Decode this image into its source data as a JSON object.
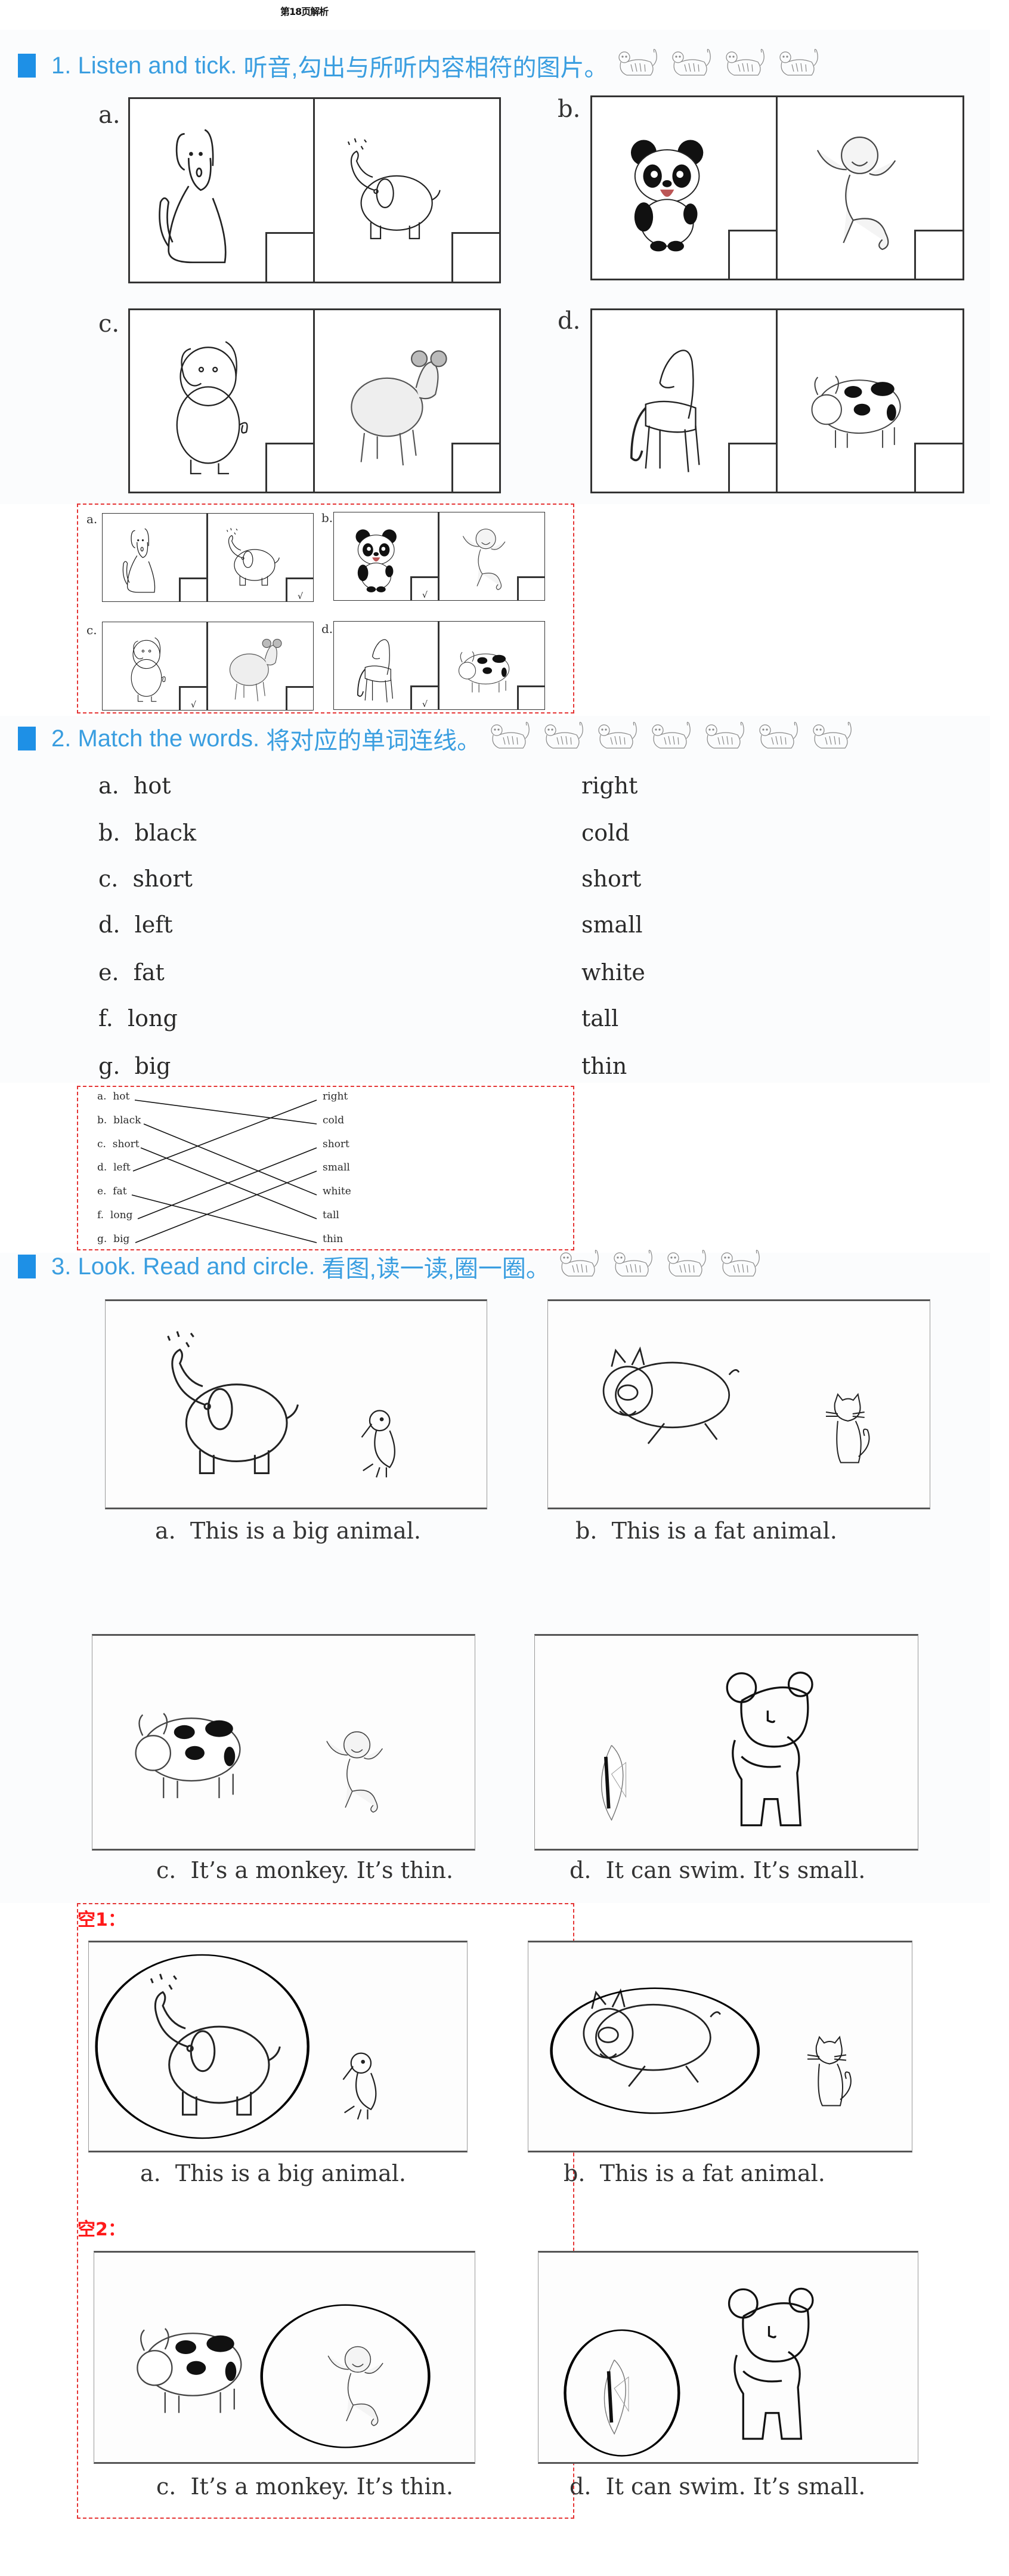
{
  "page_title": "第18页解析",
  "sections": [
    {
      "number": "1.",
      "title_en": "Listen and tick.",
      "title_zh": "听音,勾出与所听内容相符的图片。",
      "decorative_icon": "tiger-icon",
      "decorative_count": 4,
      "items": [
        {
          "letter": "a.",
          "left_animal": "dog",
          "right_animal": "elephant",
          "answer": "right"
        },
        {
          "letter": "b.",
          "left_animal": "panda",
          "right_animal": "monkey",
          "answer": "left"
        },
        {
          "letter": "c.",
          "left_animal": "pig",
          "right_animal": "sheep",
          "answer": "left"
        },
        {
          "letter": "d.",
          "left_animal": "horse",
          "right_animal": "cow",
          "answer": "left"
        }
      ],
      "tick_mark": "√"
    },
    {
      "number": "2.",
      "title_en": "Match the words.",
      "title_zh": "将对应的单词连线。",
      "decorative_icon": "tiger-icon",
      "decorative_count": 7,
      "left_words": [
        {
          "letter": "a.",
          "word": "hot"
        },
        {
          "letter": "b.",
          "word": "black"
        },
        {
          "letter": "c.",
          "word": "short"
        },
        {
          "letter": "d.",
          "word": "left"
        },
        {
          "letter": "e.",
          "word": "fat"
        },
        {
          "letter": "f.",
          "word": "long"
        },
        {
          "letter": "g.",
          "word": "big"
        }
      ],
      "right_words": [
        "right",
        "cold",
        "short",
        "small",
        "white",
        "tall",
        "thin"
      ],
      "matches": [
        {
          "from": "hot",
          "to": "cold"
        },
        {
          "from": "black",
          "to": "white"
        },
        {
          "from": "short",
          "to": "tall"
        },
        {
          "from": "left",
          "to": "right"
        },
        {
          "from": "fat",
          "to": "thin"
        },
        {
          "from": "long",
          "to": "short"
        },
        {
          "from": "big",
          "to": "small"
        }
      ]
    },
    {
      "number": "3.",
      "title_en": "Look. Read and circle.",
      "title_zh": "看图,读一读,圈一圈。",
      "decorative_icon": "tiger-icon",
      "decorative_count": 4,
      "items": [
        {
          "letter": "a.",
          "sentence": "This is a big animal.",
          "animals": [
            "elephant",
            "bird"
          ],
          "answer": "elephant"
        },
        {
          "letter": "b.",
          "sentence": "This is a fat animal.",
          "animals": [
            "pig",
            "cat"
          ],
          "answer": "pig"
        },
        {
          "letter": "c.",
          "sentence": "It’s a monkey.  It’s thin.",
          "animals": [
            "cow",
            "monkey"
          ],
          "answer": "monkey"
        },
        {
          "letter": "d.",
          "sentence": "It can swim.  It’s small.",
          "animals": [
            "fish",
            "bear"
          ],
          "answer": "fish"
        }
      ],
      "blank_labels": [
        "空1：",
        "空2："
      ]
    }
  ],
  "colors": {
    "header_blue": "#3a9ee0",
    "header_square": "#1e90e6",
    "answer_border": "#e53535",
    "blank_label": "#ff1a1a"
  }
}
